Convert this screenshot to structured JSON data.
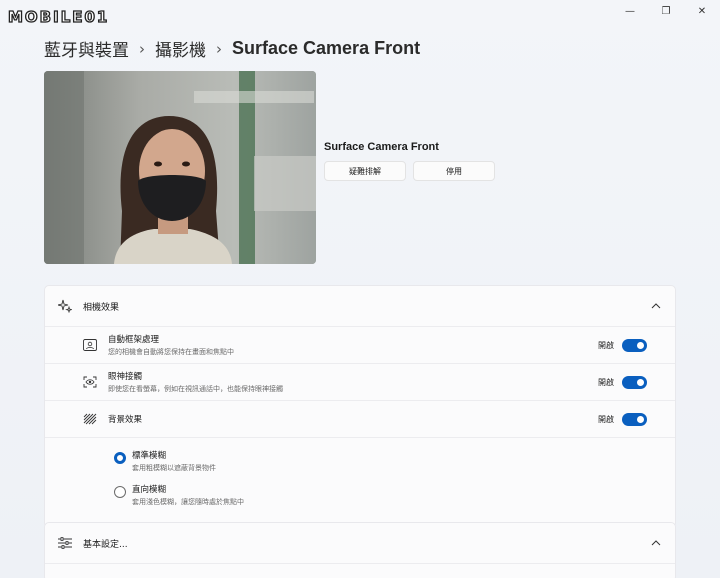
{
  "watermark": {
    "text": "MOBILE01"
  },
  "window": {
    "minimize": "—",
    "maximize": "❐",
    "close": "✕"
  },
  "breadcrumb": {
    "items": [
      "藍牙與裝置",
      "攝影機"
    ],
    "current": "Surface Camera Front",
    "separator": "›"
  },
  "camera": {
    "name": "Surface Camera Front",
    "troubleshoot_label": "疑難排解",
    "disable_label": "停用"
  },
  "effects": {
    "header": "相機效果",
    "rows": [
      {
        "title": "自動框架處理",
        "desc": "您的相機會自動將您保持在畫面和焦點中",
        "state": "開啟",
        "on": true
      },
      {
        "title": "眼神接觸",
        "desc": "即使您在看螢幕，例如在視訊通話中，也能保持眼神接觸",
        "state": "開啟",
        "on": true
      },
      {
        "title": "背景效果",
        "desc": "",
        "state": "開啟",
        "on": true
      }
    ],
    "radios": [
      {
        "title": "標準模糊",
        "desc": "套用粗模糊以遮蔽背景物件",
        "selected": true
      },
      {
        "title": "直向模糊",
        "desc": "套用淺色模糊，讓您隨時處於焦點中",
        "selected": false
      }
    ]
  },
  "basic": {
    "header": "基本設定..."
  },
  "colors": {
    "accent": "#0a5fbf"
  }
}
